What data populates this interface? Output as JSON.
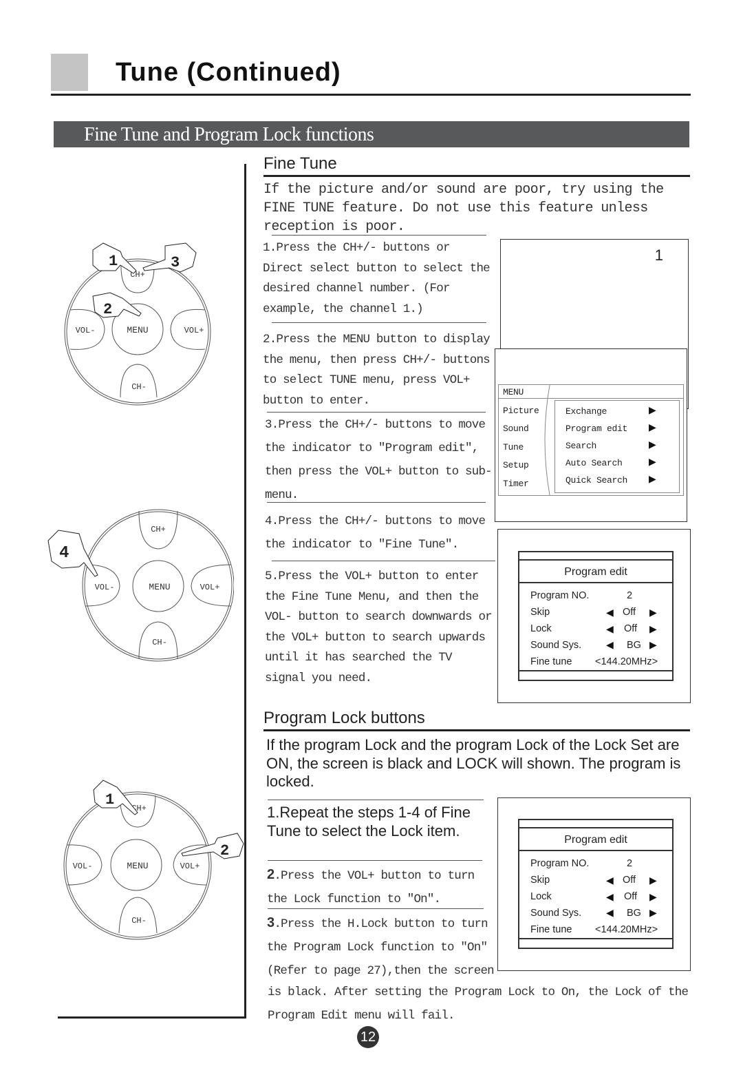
{
  "header": {
    "title": "Tune (Continued)",
    "band_title": "Fine Tune and Program Lock functions"
  },
  "fine_tune": {
    "heading": "Fine Tune",
    "intro": "If the picture and/or sound are poor, try using the FINE TUNE feature. Do not use this feature unless reception is poor.",
    "steps": [
      "1.Press the CH+/- buttons or Direct select button to select the desired channel number. (For example, the channel 1.)",
      "2.Press the MENU button to display the menu, then press CH+/- buttons to select TUNE menu, press VOL+ button to enter.",
      "3.Press the CH+/- buttons to move the indicator to \"Program edit\", then press the VOL+ button to sub-menu.",
      "4.Press the CH+/- buttons to move the indicator to \"Fine Tune\".",
      "5.Press the VOL+ button to enter the Fine Tune Menu, and then the VOL- button to search downwards or the VOL+ button to search upwards until it has searched the TV signal you need."
    ]
  },
  "screen1": {
    "channel_number": "1",
    "menu_title": "MENU",
    "left_items": [
      "Picture",
      "Sound",
      "Tune",
      "Setup",
      "Timer"
    ],
    "right_items": [
      {
        "label": "Exchange",
        "icon": "triangle-right-icon"
      },
      {
        "label": "Program edit",
        "icon": "triangle-right-icon"
      },
      {
        "label": "Search",
        "icon": "triangle-right-icon"
      },
      {
        "label": "Auto Search",
        "icon": "triangle-right-icon"
      },
      {
        "label": "Quick Search",
        "icon": "triangle-right-icon"
      }
    ]
  },
  "program_edit": {
    "title": "Program edit",
    "rows": [
      {
        "label": "Program NO.",
        "value": "2"
      },
      {
        "label": "Skip",
        "value": "Off"
      },
      {
        "label": "Lock",
        "value": "Off"
      },
      {
        "label": "Sound Sys.",
        "value": "BG"
      },
      {
        "label": "Fine tune",
        "value": "<144.20MHz>"
      }
    ]
  },
  "program_lock": {
    "heading": "Program Lock buttons",
    "intro": "If the program Lock and the program Lock of the Lock Set are ON, the screen is black and LOCK will shown. The program is locked.",
    "step1": "1.Repeat the steps 1-4 of Fine Tune to select the Lock item.",
    "step2_num": "2",
    "step2": ".Press the VOL+ button to turn the Lock function to \"On\".",
    "step3_num": "3",
    "step3": ".Press the H.Lock button to turn the Program Lock function to \"On\" (Refer to page 27),then the screen",
    "continuation": "is black. After setting the Program Lock to On, the Lock of the Program Edit menu will fail."
  },
  "remotes": {
    "buttons": {
      "ch_plus": "CH+",
      "ch_minus": "CH-",
      "vol_minus": "VOL-",
      "vol_plus": "VOL+",
      "menu": "MENU"
    },
    "remote1_steps": [
      "1",
      "2",
      "3"
    ],
    "remote2_steps": [
      "4"
    ],
    "remote3_steps": [
      "1",
      "2"
    ]
  },
  "page_number": "12"
}
